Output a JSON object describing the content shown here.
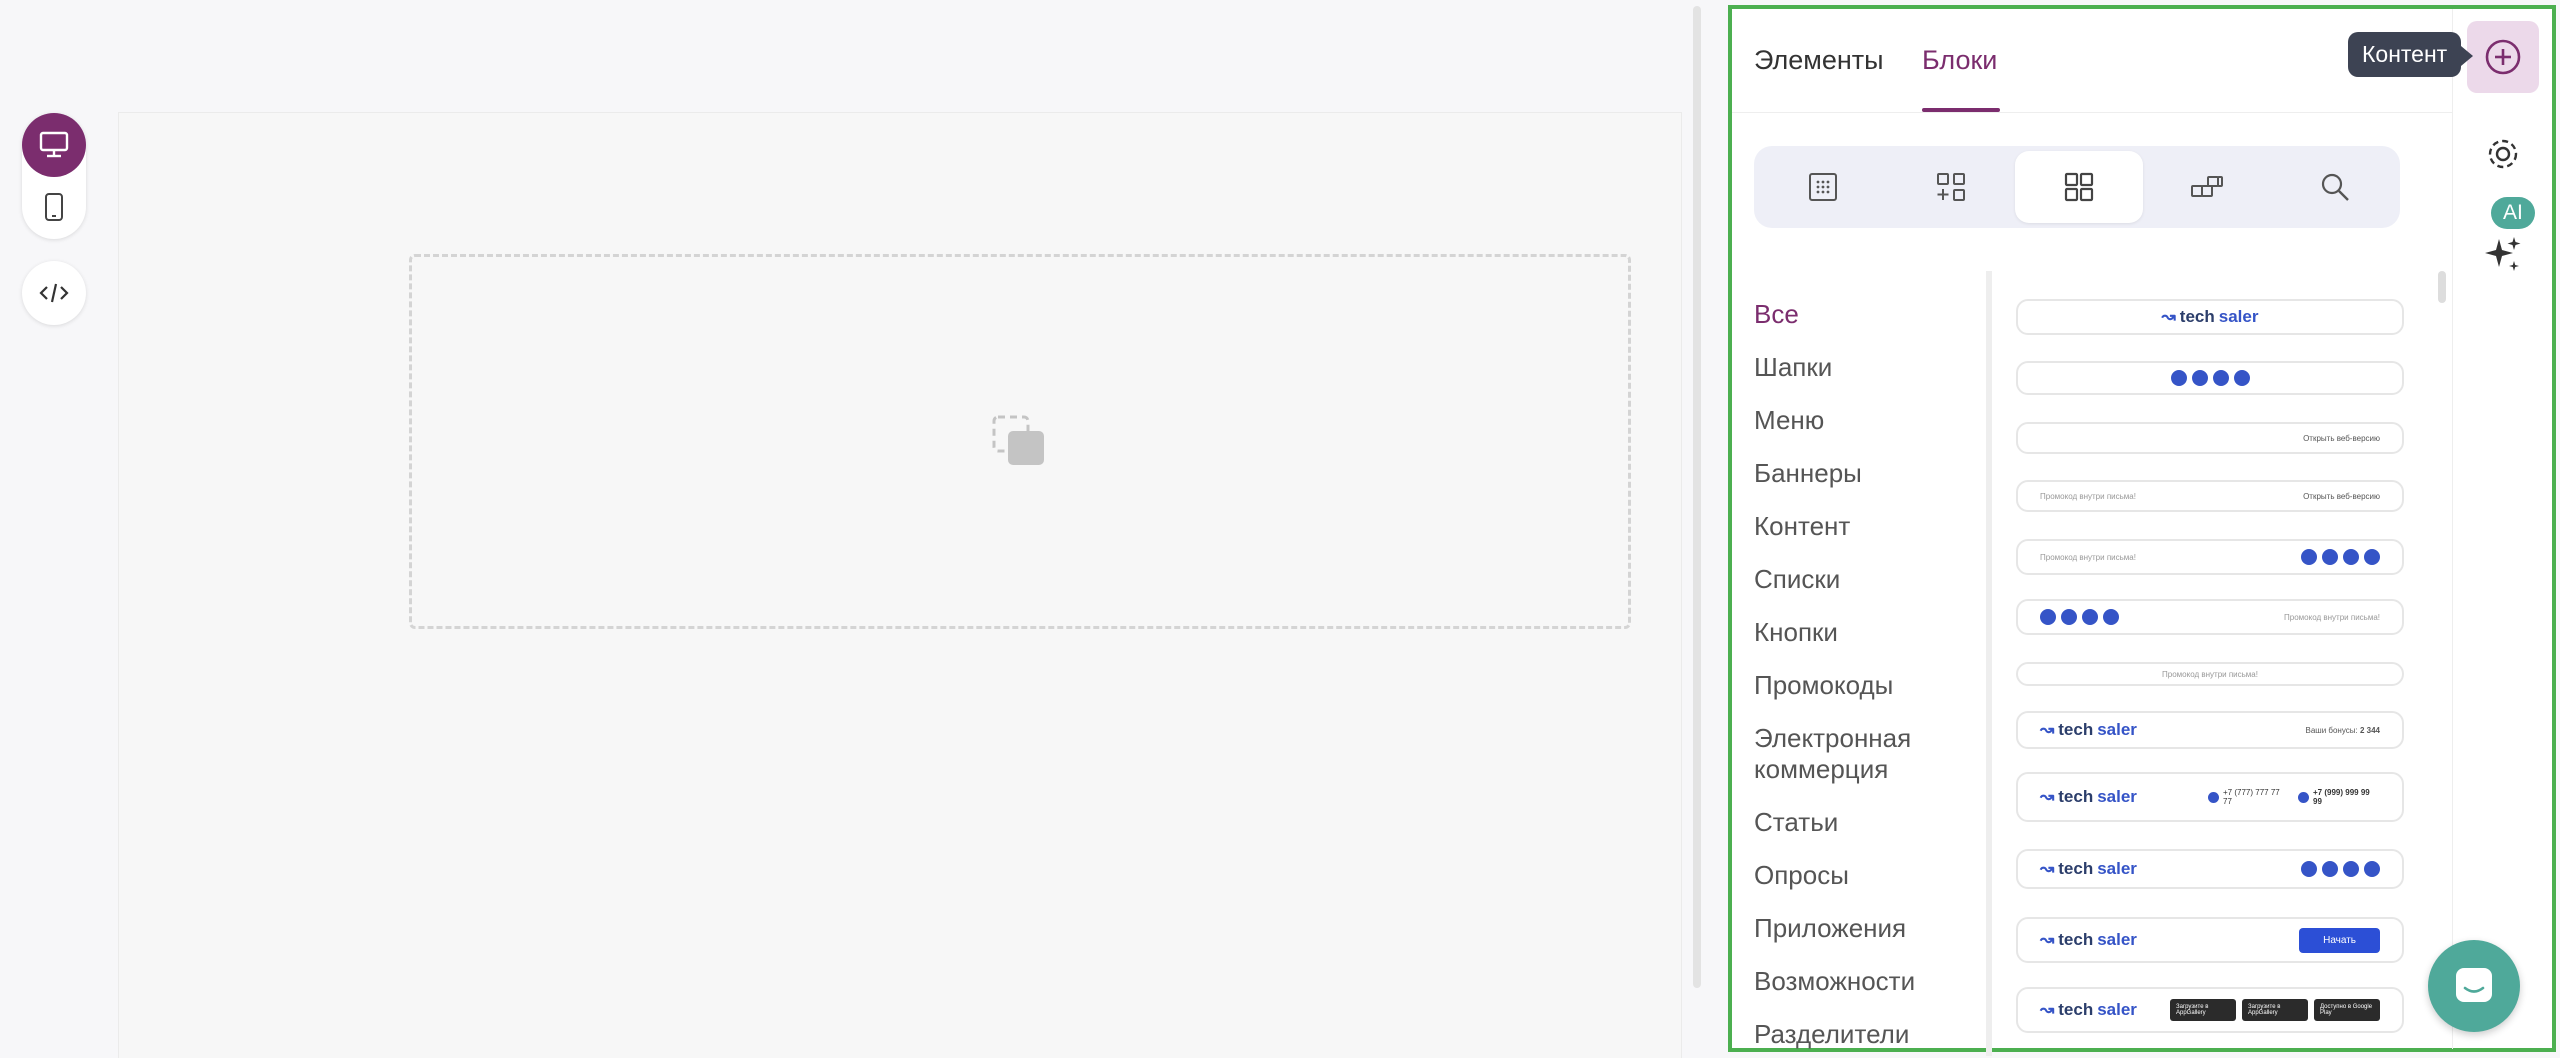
{
  "left_toolbar": {
    "desktop_icon": "desktop-icon",
    "mobile_icon": "mobile-icon",
    "code_icon": "code-icon"
  },
  "panel": {
    "tabs": [
      {
        "label": "Элементы",
        "active": false
      },
      {
        "label": "Блоки",
        "active": true
      }
    ],
    "filter_icons": [
      "grid-dots-icon",
      "add-blocks-icon",
      "blocks-grid-icon",
      "layers-icon",
      "search-icon"
    ],
    "categories": [
      "Все",
      "Шапки",
      "Меню",
      "Баннеры",
      "Контент",
      "Списки",
      "Кнопки",
      "Промокоды",
      "Электронная коммерция",
      "Статьи",
      "Опросы",
      "Приложения",
      "Возможности",
      "Разделители"
    ],
    "active_category": "Все"
  },
  "previews": {
    "logo_prefix": "tech",
    "logo_suffix": "saler",
    "web_version": "Открыть веб-версию",
    "promo_inside": "Промокод внутри письма!",
    "bonuses_label": "Ваши бонусы:",
    "bonuses_value": "2 344",
    "phone_1": "+7 (777) 777 77 77",
    "phone_2": "+7 (999) 999 99 99",
    "start_button": "Начать",
    "store_1": "Загрузите в AppGallery",
    "store_2": "Загрузите в AppGallery",
    "store_3": "Доступно в Google Play"
  },
  "rail": {
    "tooltip": "Контент",
    "ai_badge": "AI"
  },
  "colors": {
    "accent": "#7b2d6e",
    "highlight_border": "#4caf50",
    "ai": "#4fa99a"
  }
}
